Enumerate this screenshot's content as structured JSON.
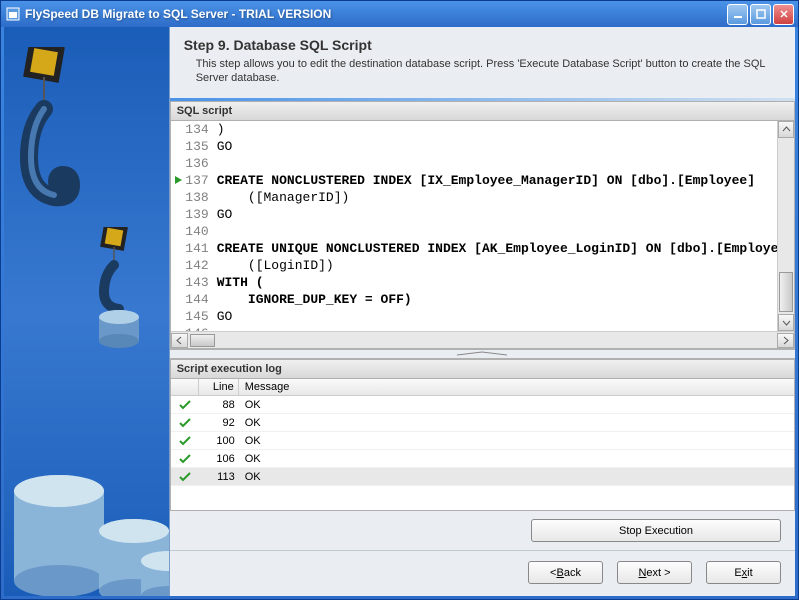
{
  "window": {
    "title": "FlySpeed DB Migrate to SQL Server - TRIAL VERSION"
  },
  "header": {
    "title": "Step 9. Database SQL Script",
    "description": "This step allows you to edit the destination database script. Press 'Execute Database Script' button to create the SQL Server database."
  },
  "sql_panel": {
    "label": "SQL script",
    "lines": [
      {
        "num": 134,
        "text": ")",
        "arrow": false
      },
      {
        "num": 135,
        "text": "GO",
        "arrow": false
      },
      {
        "num": 136,
        "text": "",
        "arrow": false
      },
      {
        "num": 137,
        "text": "CREATE NONCLUSTERED INDEX [IX_Employee_ManagerID] ON [dbo].[Employee]",
        "arrow": true,
        "bold": true
      },
      {
        "num": 138,
        "text": "    ([ManagerID])",
        "arrow": false
      },
      {
        "num": 139,
        "text": "GO",
        "arrow": false
      },
      {
        "num": 140,
        "text": "",
        "arrow": false
      },
      {
        "num": 141,
        "text": "CREATE UNIQUE NONCLUSTERED INDEX [AK_Employee_LoginID] ON [dbo].[Employee]",
        "arrow": false,
        "bold": true
      },
      {
        "num": 142,
        "text": "    ([LoginID])",
        "arrow": false
      },
      {
        "num": 143,
        "text": "WITH (",
        "arrow": false,
        "bold": true
      },
      {
        "num": 144,
        "text": "    IGNORE_DUP_KEY = OFF)",
        "arrow": false,
        "bold": true
      },
      {
        "num": 145,
        "text": "GO",
        "arrow": false
      },
      {
        "num": 146,
        "text": "",
        "arrow": false
      }
    ]
  },
  "log_panel": {
    "label": "Script execution log",
    "columns": {
      "icon": "",
      "line": "Line",
      "message": "Message"
    },
    "rows": [
      {
        "line": 88,
        "message": "OK"
      },
      {
        "line": 92,
        "message": "OK"
      },
      {
        "line": 100,
        "message": "OK"
      },
      {
        "line": 106,
        "message": "OK"
      },
      {
        "line": 113,
        "message": "OK"
      }
    ]
  },
  "buttons": {
    "stop": "Stop Execution",
    "back": "< Back",
    "next": "Next >",
    "exit": "Exit"
  }
}
